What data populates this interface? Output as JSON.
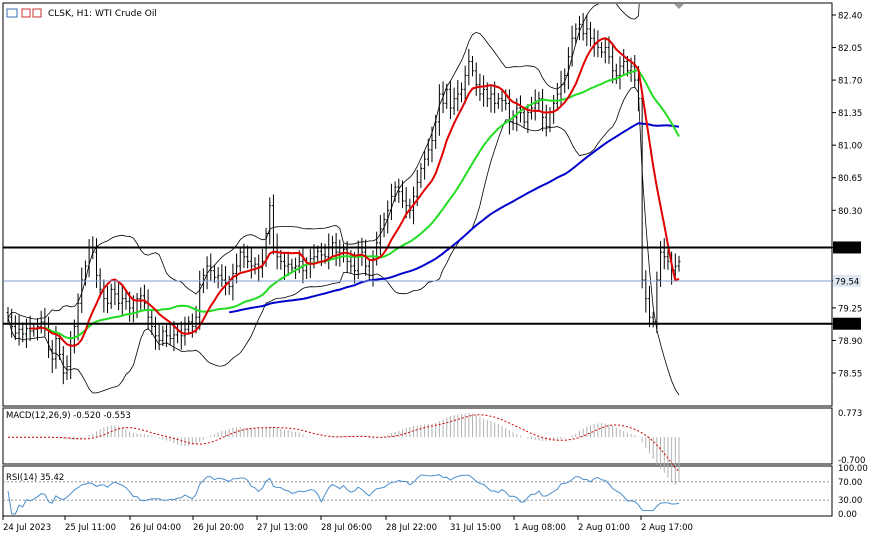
{
  "header": {
    "symbol_label": "CLSK, H1:  WTI Crude Oil"
  },
  "colors": {
    "bull": "#000000",
    "bear": "#000000",
    "bollinger": "#000000",
    "ma_fast": "#e00000",
    "ma_mid": "#22dd22",
    "ma_slow": "#0000cc",
    "macd_hist": "#b0b0b0",
    "macd_signal": "#cc0000",
    "rsi": "#4a8fcf",
    "level_lines": "#000000",
    "price_line": "#7f9fcf"
  },
  "chart_data": [
    {
      "type": "candlestick",
      "title": "CLSK, H1:  WTI Crude Oil",
      "ylim": [
        78.2,
        82.5
      ],
      "y_ticks": [
        82.4,
        82.05,
        81.7,
        81.35,
        81.0,
        80.65,
        80.3,
        79.9,
        79.54,
        79.25,
        79.08,
        78.9,
        78.55
      ],
      "y_tick_labels": [
        "82.40",
        "82.05",
        "81.70",
        "81.35",
        "81.00",
        "80.65",
        "80.30",
        "79.90",
        "79.54",
        "79.25",
        "79.08",
        "78.90",
        "78.55"
      ],
      "highlighted_levels": [
        {
          "label": "79.90",
          "value": 79.9
        },
        {
          "label": "79.08",
          "value": 79.08
        },
        {
          "label": "79.54",
          "value": 79.54
        }
      ],
      "current_price": 79.54,
      "x_labels": [
        "24 Jul 2023",
        "25 Jul 11:00",
        "26 Jul 04:00",
        "26 Jul 20:00",
        "27 Jul 13:00",
        "28 Jul 06:00",
        "28 Jul 22:00",
        "31 Jul 15:00",
        "1 Aug 08:00",
        "2 Aug 01:00",
        "2 Aug 17:00"
      ],
      "close": [
        79.15,
        79.05,
        78.98,
        79.02,
        78.97,
        79.03,
        79.0,
        79.02,
        79.05,
        79.1,
        79.08,
        78.8,
        78.7,
        78.92,
        78.75,
        78.55,
        78.62,
        78.85,
        79.05,
        79.3,
        79.55,
        79.7,
        79.9,
        79.85,
        79.6,
        79.45,
        79.35,
        79.3,
        79.45,
        79.4,
        79.3,
        79.35,
        79.32,
        79.25,
        79.2,
        79.35,
        79.38,
        79.3,
        79.15,
        79.05,
        78.95,
        78.9,
        79.0,
        78.95,
        78.92,
        78.96,
        79.0,
        78.95,
        79.02,
        79.1,
        79.05,
        79.15,
        79.5,
        79.6,
        79.7,
        79.65,
        79.58,
        79.6,
        79.55,
        79.52,
        79.48,
        79.62,
        79.7,
        79.85,
        79.8,
        79.75,
        79.7,
        79.72,
        79.68,
        79.75,
        80.05,
        80.35,
        79.9,
        79.8,
        79.75,
        79.7,
        79.72,
        79.68,
        79.7,
        79.75,
        79.65,
        79.72,
        79.78,
        79.8,
        79.86,
        79.82,
        79.8,
        79.9,
        79.95,
        79.85,
        79.8,
        79.88,
        79.75,
        79.7,
        79.65,
        79.9,
        79.85,
        79.7,
        79.6,
        79.78,
        79.95,
        80.1,
        80.2,
        80.3,
        80.45,
        80.55,
        80.5,
        80.4,
        80.35,
        80.3,
        80.45,
        80.6,
        80.75,
        80.85,
        80.95,
        81.05,
        81.25,
        81.55,
        81.45,
        81.6,
        81.4,
        81.5,
        81.55,
        81.6,
        81.75,
        81.9,
        81.8,
        81.65,
        81.55,
        81.6,
        81.5,
        81.55,
        81.45,
        81.5,
        81.48,
        81.45,
        81.25,
        81.3,
        81.4,
        81.35,
        81.25,
        81.35,
        81.4,
        81.45,
        81.5,
        81.3,
        81.2,
        81.35,
        81.45,
        81.55,
        81.65,
        81.75,
        81.95,
        82.15,
        82.25,
        82.3,
        82.2,
        82.25,
        82.15,
        82.1,
        82.05,
        82.0,
        82.05,
        81.95,
        81.8,
        81.75,
        81.85,
        81.9,
        81.8,
        81.85,
        81.7,
        81.5,
        79.55,
        79.35,
        79.15,
        79.1,
        79.55,
        79.85,
        79.8,
        79.75,
        79.65,
        79.7,
        79.75
      ],
      "indicators": {
        "bollinger_bands": "BB(20,2)",
        "moving_averages": [
          "MA fast",
          "MA mid",
          "MA slow"
        ]
      }
    },
    {
      "type": "macd",
      "label": "MACD(12,26,9) -0.520 -0.553",
      "ylim": [
        -0.7,
        0.773
      ],
      "y_tick_labels": [
        "0.773",
        "-0.700"
      ],
      "macd_last": -0.52,
      "signal_last": -0.553
    },
    {
      "type": "line",
      "label": "RSI(14) 35.42",
      "ylim": [
        0,
        100
      ],
      "y_tick_labels": [
        "100.00",
        "70.00",
        "30.00",
        "0.00"
      ],
      "rsi_last": 35.42
    }
  ]
}
